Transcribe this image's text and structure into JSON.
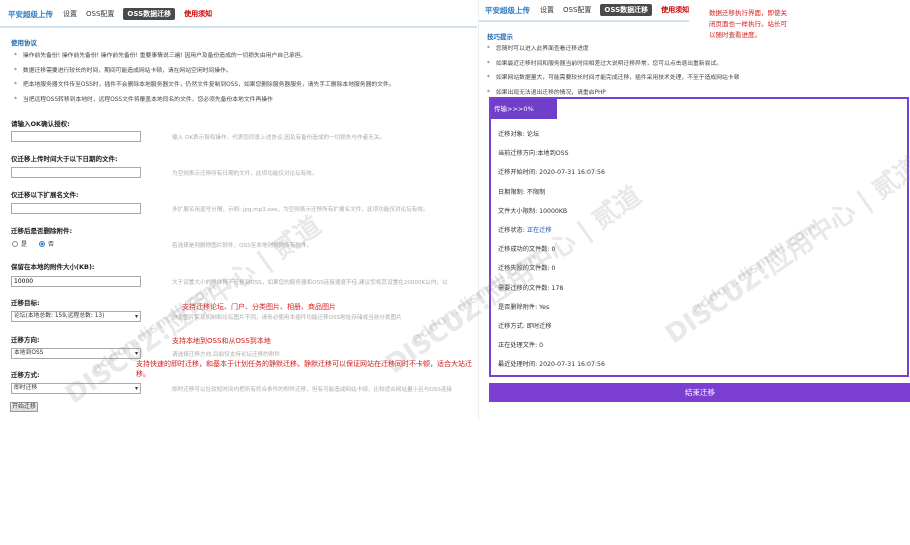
{
  "left": {
    "tabs": {
      "brand": "平安超级上传",
      "items": [
        "设置",
        "OSS配置",
        "OSS数据迁移",
        "使用须知"
      ]
    },
    "protocol_title": "使用协议",
    "notes": [
      "操作前先备份! 操作前先备份! 操作前先备份! 重要事情说三遍! 因用户及备份造成的一切损失由用户自己承担。",
      "数据迁移需要进行较长的时间，期间可能造成网站卡顿，请在网站空闲时间操作。",
      "把本地服务器文件传至OSS时，插件不会删除本地服务器文件，仍然文件复制到OSS，如果您删除服务器服务，请先手工删除本地服务器的文件。",
      "当把远程OSS转移到本地时，远程OSS文件将覆盖本地同名的文件，您必须先备份本地文件再操作"
    ],
    "fields": {
      "ok": {
        "label": "请输入OK确认授权:",
        "value": "",
        "hint": "输入 OK表示授权操作，代表您同意上述协议,因及有备份造成的一切损失与作者无关。"
      },
      "date": {
        "label": "仅迁移上传时间大于以下日期的文件:",
        "value": "",
        "hint": "为空则表示迁移所有日期的文件，此项功能仅对论坛有效。"
      },
      "ext": {
        "label": "仅迁移以下扩展名文件:",
        "value": "",
        "hint": "多扩展名用逗号分隔，示例: jpg,mp3,exe，为空则表示迁移所有扩展名文件，此项功能仅对论坛有效。"
      },
      "delete": {
        "label": "迁移后是否删除附件:",
        "opt_yes": "是",
        "opt_no": "否",
        "hint": "若选择是则删除图片附件，OSS至本地则删除所有附件。"
      },
      "size": {
        "label": "保留在本地的附件大小(KB):",
        "value": "10000",
        "hint": "大于设置大小的附件将不迁移到OSS，如果您的服务器和OSS连接速度不佳,建议您将其设置在20000K以内，以"
      },
      "object": {
        "label": "迁移目标:",
        "selected": "论坛(本地总数: 159,远程总数: 13)",
        "hint": "分类图片实现机制和论坛图片不同，请务必使用本插件功能迁移OSS地址存储或当前分类图片"
      },
      "direction": {
        "label": "迁移方向:",
        "selected": "本地到OSS",
        "hint": "请选择迁移方向,目前仅支持论坛迁移的附件"
      },
      "mode": {
        "label": "迁移方式:",
        "selected": "即时迁移",
        "hint": "即时迁移可以在较短时间内把所有符合条件的附件迁移，但有可能造成网站卡顿，比较适合网站量小且与OSS连接"
      }
    },
    "annotations": {
      "a1": "支持迁移论坛、门户、分类图片、相册、商品图片",
      "a2": "支持本地到OSS和从OSS到本地",
      "a3": "支持快速的即时迁移，和基本于计划任务的静默迁移。静默迁移可以保证网站在迁移同时不卡顿，适合大站迁移。"
    },
    "start_button": "开始迁移"
  },
  "right": {
    "tabs": {
      "brand": "平安超级上传",
      "items": [
        "设置",
        "OSS配置",
        "OSS数据迁移",
        "使用须知"
      ]
    },
    "tips_title": "技巧提示",
    "notes": [
      "您随时可以进入此界面查看迁移进度",
      "如果最近迁移时间和服务器当前时间相差过大说明迁移异常，您可以点击退出重新尝试。",
      "如果网站数据量大，可能需要较长时间才能完成迁移，插件采用技术处理，不至于造成网站卡顿",
      "如果出现无法退出迁移的情况，请重启PHP"
    ],
    "annotation": "数据迁移执行界面，即使关闭页面也一样执行。站长可以随时查看进度。",
    "progress_label": "传输>>>0%",
    "progress_value": 0,
    "info": {
      "object": "迁移对象: 论坛",
      "direction": "当前迁移方向:本地到OSS",
      "start_time": "迁移开始时间: 2020-07-31 16:07:56",
      "date_limit": "日期限制: 不限制",
      "size_limit": "文件大小限制: 10000KB",
      "status_label": "迁移状态: ",
      "status_value": "正在迁移",
      "done": "迁移成功的文件数: 0",
      "failed": "迁移失败的文件数: 0",
      "pending": "需要迁移的文件数: 178",
      "delete": "是否删除附件: Yes",
      "mode": "迁移方式: 即时迁移",
      "processing": "正在处理文件: 0",
      "last_time": "最近处理时间: 2020-07-31 16:07:56"
    },
    "end_button": "结束迁移"
  },
  "watermark": "DISCUZ!应用中心 | 贰道",
  "watermark_sub": "addon.dismall.com"
}
